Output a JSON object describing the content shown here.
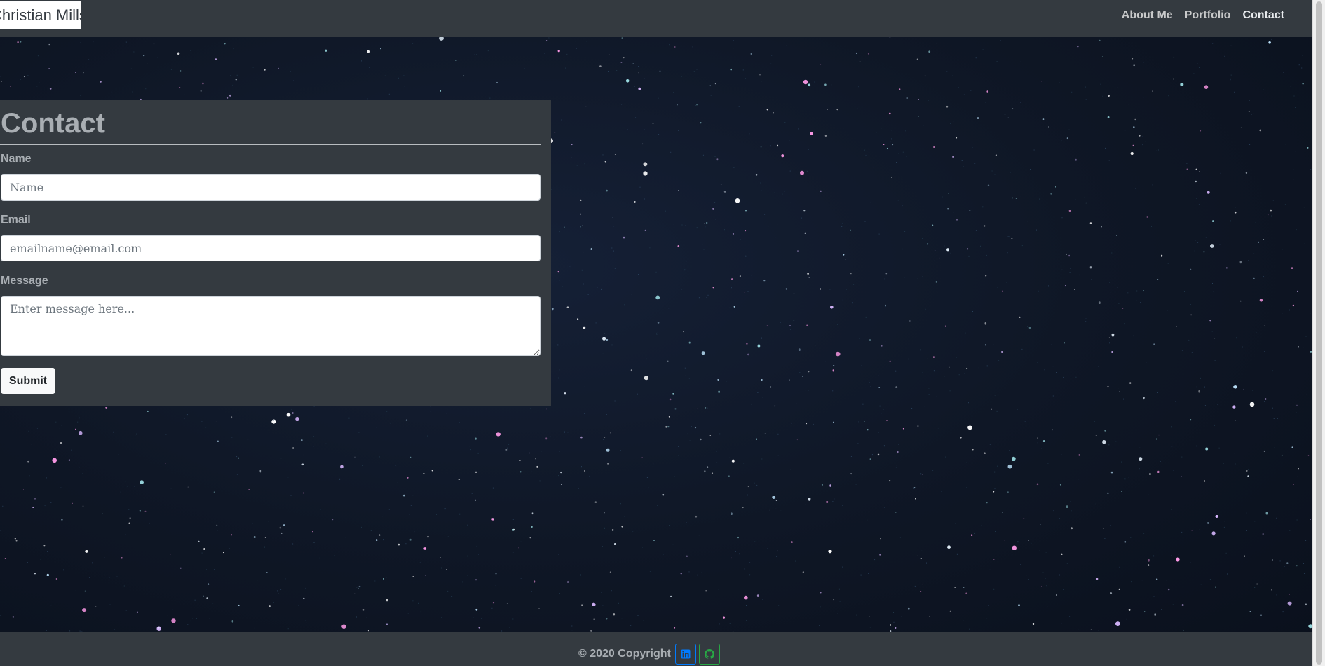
{
  "navbar": {
    "brand": "Christian Mills",
    "links": [
      {
        "label": "About Me"
      },
      {
        "label": "Portfolio"
      },
      {
        "label": "Contact"
      }
    ]
  },
  "contact": {
    "title": "Contact",
    "name_label": "Name",
    "name_placeholder": "Name",
    "email_label": "Email",
    "email_placeholder": "emailname@email.com",
    "message_label": "Message",
    "message_placeholder": "Enter message here...",
    "submit_label": "Submit"
  },
  "footer": {
    "copyright": "© 2020 Copyright",
    "social": [
      {
        "icon": "linkedin-icon",
        "color": "#007bff"
      },
      {
        "icon": "github-icon",
        "color": "#28a745"
      }
    ]
  },
  "colors": {
    "panel": "#343a40",
    "sky": "#0f1624",
    "text_muted": "#a9aeb3"
  }
}
